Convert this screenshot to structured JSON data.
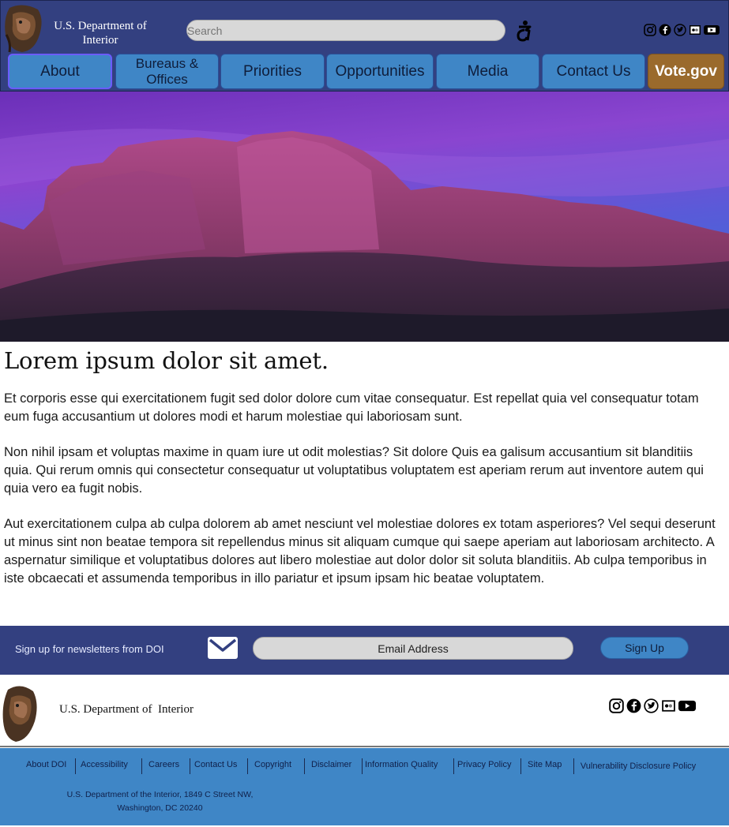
{
  "header": {
    "title": "U.S. Department of Interior",
    "search_placeholder": "Search",
    "social": [
      "instagram-icon",
      "facebook-icon",
      "twitter-icon",
      "flickr-icon",
      "youtube-icon"
    ]
  },
  "nav": {
    "items": [
      {
        "label": "About"
      },
      {
        "label": "Bureaus & Offices"
      },
      {
        "label": "Priorities"
      },
      {
        "label": "Opportunities"
      },
      {
        "label": "Media"
      },
      {
        "label": "Contact Us"
      },
      {
        "label": "Vote.gov"
      }
    ]
  },
  "main": {
    "headline": "Lorem ipsum dolor sit amet.",
    "paragraphs": [
      "Et corporis esse qui exercitationem fugit sed dolor dolore cum vitae consequatur. Est repellat quia vel consequatur totam eum fuga accusantium ut dolores modi et harum molestiae qui laboriosam sunt.",
      "Non nihil ipsam et voluptas maxime in quam iure ut odit molestias? Sit dolore Quis ea galisum accusantium sit blanditiis quia. Qui rerum omnis qui consectetur consequatur ut voluptatibus voluptatem est aperiam rerum aut inventore autem qui quia vero ea fugit nobis.",
      "Aut exercitationem culpa ab culpa dolorem ab amet nesciunt vel molestiae dolores ex totam asperiores? Vel sequi deserunt ut minus sint non beatae tempora sit repellendus minus sit aliquam cumque qui saepe aperiam aut laboriosam architecto. A aspernatur similique et voluptatibus dolores aut libero molestiae aut dolor dolor sit soluta blanditiis. Ab culpa temporibus in iste obcaecati et assumenda temporibus in illo pariatur et ipsum ipsam hic beatae voluptatem."
    ]
  },
  "newsletter": {
    "text": "Sign up for newsletters from DOI",
    "email_placeholder": "Email Address",
    "button": "Sign Up"
  },
  "footer": {
    "title": "U.S. Department of  Interior",
    "links": [
      {
        "label": "About DOI"
      },
      {
        "label": "Accessibility"
      },
      {
        "label": "Careers"
      },
      {
        "label": "Contact Us"
      },
      {
        "label": "Copyright"
      },
      {
        "label": "Disclaimer"
      },
      {
        "label": "Information Quality"
      },
      {
        "label": "Privacy Policy"
      },
      {
        "label": "Site Map"
      },
      {
        "label": "Vulnerability Disclosure Policy"
      }
    ],
    "address_line1": "U.S. Department of the Interior, 1849 C Street NW,",
    "address_line2": "Washington, DC 20240"
  },
  "colors": {
    "header_bg": "#334080",
    "nav_button": "#3f86c6",
    "vote_button": "#9a6a2c",
    "footer_links_bg": "#3f86c6"
  }
}
